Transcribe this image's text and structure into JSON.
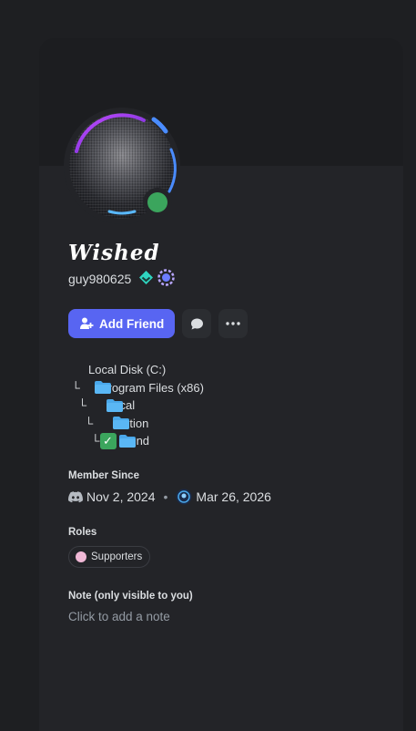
{
  "profile": {
    "display_name": "Wished",
    "username": "guy980625",
    "status": "online"
  },
  "actions": {
    "add_friend_label": "Add Friend",
    "message_icon": "chat-bubble-icon",
    "more_icon": "ellipsis-icon"
  },
  "bio": {
    "lines": [
      {
        "prefix": "",
        "text": "Local Disk (C:)",
        "icon": "folder"
      },
      {
        "prefix": " └",
        "text": "Program Files (x86)",
        "icon": "folder"
      },
      {
        "prefix": "   └",
        "text": "Local",
        "icon": "folder"
      },
      {
        "prefix": "     └",
        "text": "Motion",
        "icon": "folder"
      },
      {
        "prefix": "       └",
        "text": "found",
        "icon": "check"
      }
    ]
  },
  "member_since": {
    "title": "Member Since",
    "discord_date": "Nov 2, 2024",
    "server_date": "Mar 26, 2026"
  },
  "roles": {
    "title": "Roles",
    "items": [
      {
        "name": "Supporters",
        "color": "#f0b8d6"
      }
    ]
  },
  "note": {
    "title": "Note (only visible to you)",
    "placeholder": "Click to add a note"
  },
  "colors": {
    "accent": "#5865f2",
    "online": "#3ba55d",
    "card_bg": "#232428"
  }
}
